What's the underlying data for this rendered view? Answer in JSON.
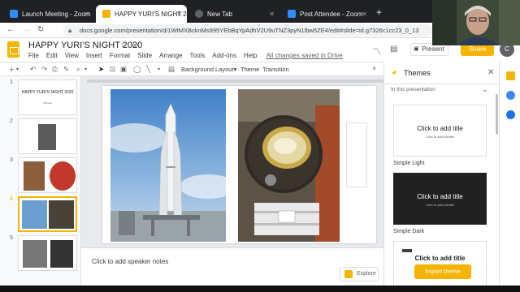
{
  "browser": {
    "tabs": [
      {
        "title": "Launch Meeting - Zoom",
        "favicon_color": "#2d8cff",
        "active": false
      },
      {
        "title": "HAPPY YURI'S NIGHT 2020 - Goo",
        "favicon_color": "#f4b400",
        "active": true
      },
      {
        "title": "New Tab",
        "favicon_color": "#5f6368",
        "active": false
      },
      {
        "title": "Post Attendee - Zoom",
        "favicon_color": "#2d8cff",
        "active": false
      }
    ],
    "new_tab_label": "+",
    "url": "docs.google.com/presentation/d/1WtMXBcknMs995YEbBqYpAdhV2U9uTNZ3pyN1lbw5ZE4/edit#slide=id.g7326c1cc23_0_13"
  },
  "app": {
    "doc_title": "HAPPY YURI'S NIGHT 2020",
    "menu": [
      "File",
      "Edit",
      "View",
      "Insert",
      "Format",
      "Slide",
      "Arrange",
      "Tools",
      "Add-ons",
      "Help"
    ],
    "save_status": "All changes saved in Drive",
    "present_label": "Present",
    "share_label": "Share",
    "avatar_letter": "C"
  },
  "toolbar": {
    "background_label": "Background",
    "layout_label": "Layout▾",
    "theme_label": "Theme",
    "transition_label": "Transition"
  },
  "filmstrip": {
    "slides": [
      {
        "number": "1",
        "title": "HAPPY YURI'S NIGHT 2020",
        "subtitle": "Michael",
        "colors": []
      },
      {
        "number": "2",
        "title": "",
        "subtitle": "",
        "colors": [
          "#5a5a5a"
        ]
      },
      {
        "number": "3",
        "title": "",
        "subtitle": "",
        "colors": [
          "#8b5e3c",
          "#c0392b"
        ]
      },
      {
        "number": "4",
        "title": "",
        "subtitle": "",
        "colors": [
          "#6d9ed0",
          "#4b4237"
        ]
      },
      {
        "number": "5",
        "title": "",
        "subtitle": "",
        "colors": [
          "#777777",
          "#333333"
        ]
      }
    ]
  },
  "editor": {
    "notes_placeholder": "Click to add speaker notes",
    "explore_label": "Explore"
  },
  "themes_panel": {
    "title": "Themes",
    "section_label": "In this presentation",
    "items": [
      {
        "name": "Simple Light",
        "card_title": "Click to add title",
        "card_subtitle": "Click to add subtitle",
        "bg": "#ffffff",
        "fg": "#202124"
      },
      {
        "name": "Simple Dark",
        "card_title": "Click to add title",
        "card_subtitle": "Click to add subtitle",
        "bg": "#212121",
        "fg": "#ffffff"
      },
      {
        "name": "",
        "card_title": "Click to add title",
        "card_subtitle": "",
        "bg": "#ffffff",
        "fg": "#202124"
      }
    ],
    "import_label": "Import theme"
  },
  "colors": {
    "accent": "#f4b400",
    "zoom_blue": "#2d8cff"
  }
}
